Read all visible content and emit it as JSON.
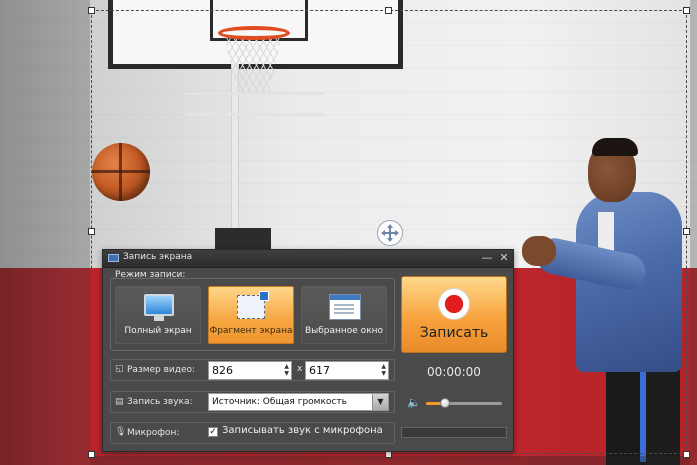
{
  "window": {
    "title": "Запись экрана",
    "minimize_glyph": "—",
    "close_glyph": "✕"
  },
  "mode": {
    "label": "Режим записи:",
    "options": [
      {
        "label": "Полный экран",
        "icon": "monitor-icon",
        "active": false
      },
      {
        "label": "Фрагмент экрана",
        "icon": "screen-fragment-icon",
        "active": true
      },
      {
        "label": "Выбранное окно",
        "icon": "app-window-icon",
        "active": false
      }
    ]
  },
  "record": {
    "label": "Записать",
    "timer": "00:00:00"
  },
  "video_size": {
    "label": "Размер видео:",
    "width": "826",
    "height": "617",
    "separator": "x"
  },
  "audio": {
    "label": "Запись звука:",
    "source": "Источник: Общая громкость",
    "volume": 0.25
  },
  "microphone": {
    "label": "Микрофон:",
    "checkbox_label": "Записывать звук с микрофона",
    "checked": true
  },
  "colors": {
    "accent": "#f6a640",
    "record_dot": "#e11d1d",
    "panel": "#4a4a4a"
  }
}
